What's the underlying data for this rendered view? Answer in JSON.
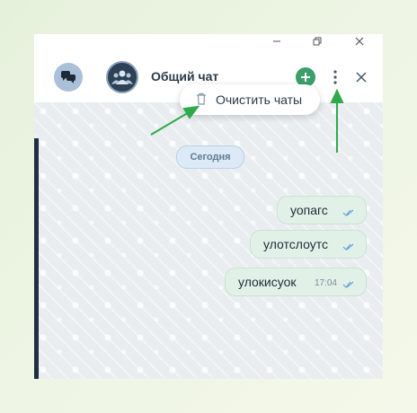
{
  "chat": {
    "title": "Общий чат",
    "date_label": "Сегодня"
  },
  "menu": {
    "clear_label": "Очистить чаты"
  },
  "messages": [
    {
      "text": "уопагс",
      "time": ""
    },
    {
      "text": "улотслоутс",
      "time": ""
    },
    {
      "text": "улокисуок",
      "time": "17:04"
    }
  ],
  "icons": {
    "chats": "chat-bubbles-icon",
    "group": "group-avatar-icon",
    "add": "plus-icon",
    "more": "more-vertical-icon",
    "close": "close-icon",
    "trash": "trash-icon",
    "read": "double-check-icon",
    "minimize": "minimize-icon",
    "restore": "restore-icon"
  },
  "colors": {
    "accent_green": "#3aa06a",
    "header_text": "#2b3a48",
    "message_bg": "#e2f1e8",
    "annotation_arrow": "#2eaa4a"
  }
}
